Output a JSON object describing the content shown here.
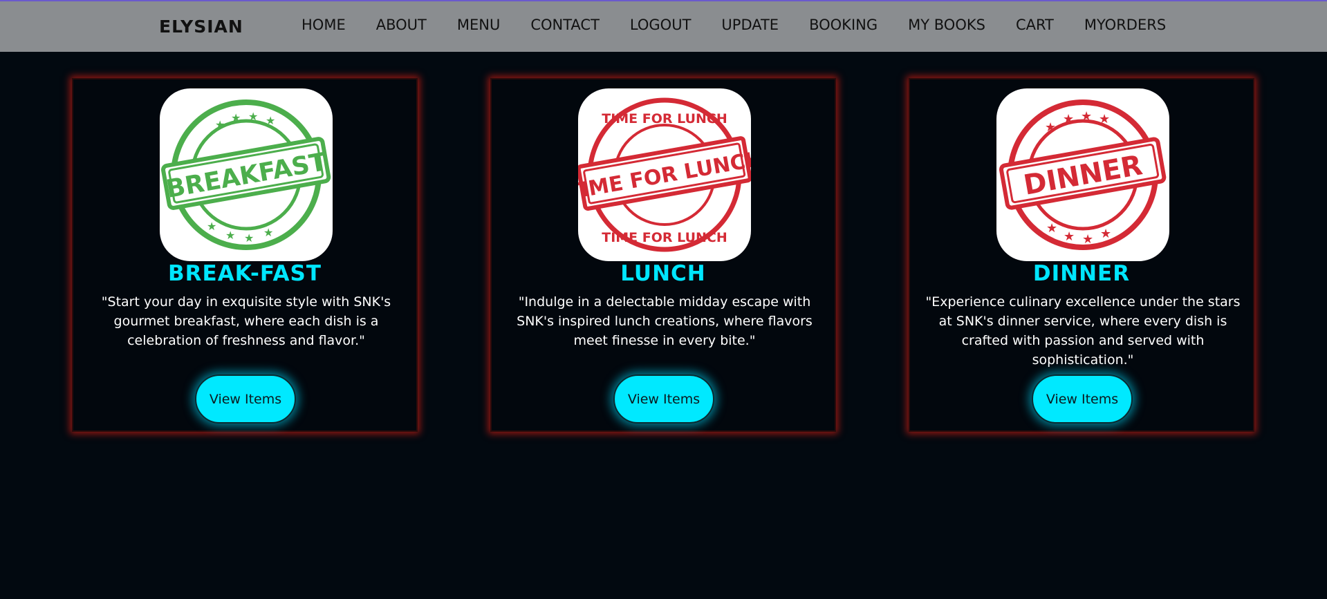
{
  "nav": {
    "brand": "ELYSIAN",
    "links": [
      "HOME",
      "ABOUT",
      "MENU",
      "CONTACT",
      "LOGOUT",
      "UPDATE",
      "BOOKING",
      "MY BOOKS",
      "CART",
      "MYORDERS"
    ]
  },
  "cards": [
    {
      "title": "BREAK-FAST",
      "description": "\"Start your day in exquisite style with SNK's gourmet breakfast, where each dish is a celebration of freshness and flavor.\"",
      "button_label": "View Items",
      "stamp_text": "BREAKFAST",
      "stamp_color": "#4cae4c"
    },
    {
      "title": "LUNCH",
      "description": "\"Indulge in a delectable midday escape with SNK's inspired lunch creations, where flavors meet finesse in every bite.\"",
      "button_label": "View Items",
      "stamp_text": "TIME FOR LUNCH",
      "stamp_color": "#d42a35"
    },
    {
      "title": "DINNER",
      "description": "\"Experience culinary excellence under the stars at SNK's dinner service, where every dish is crafted with passion and served with sophistication.\"",
      "button_label": "View Items",
      "stamp_text": "DINNER",
      "stamp_color": "#d42a35"
    }
  ],
  "colors": {
    "navbar_bg": "#8a8d90",
    "page_bg": "#020910",
    "accent_cyan": "#00e6ff",
    "card_glow": "#c81e14"
  }
}
